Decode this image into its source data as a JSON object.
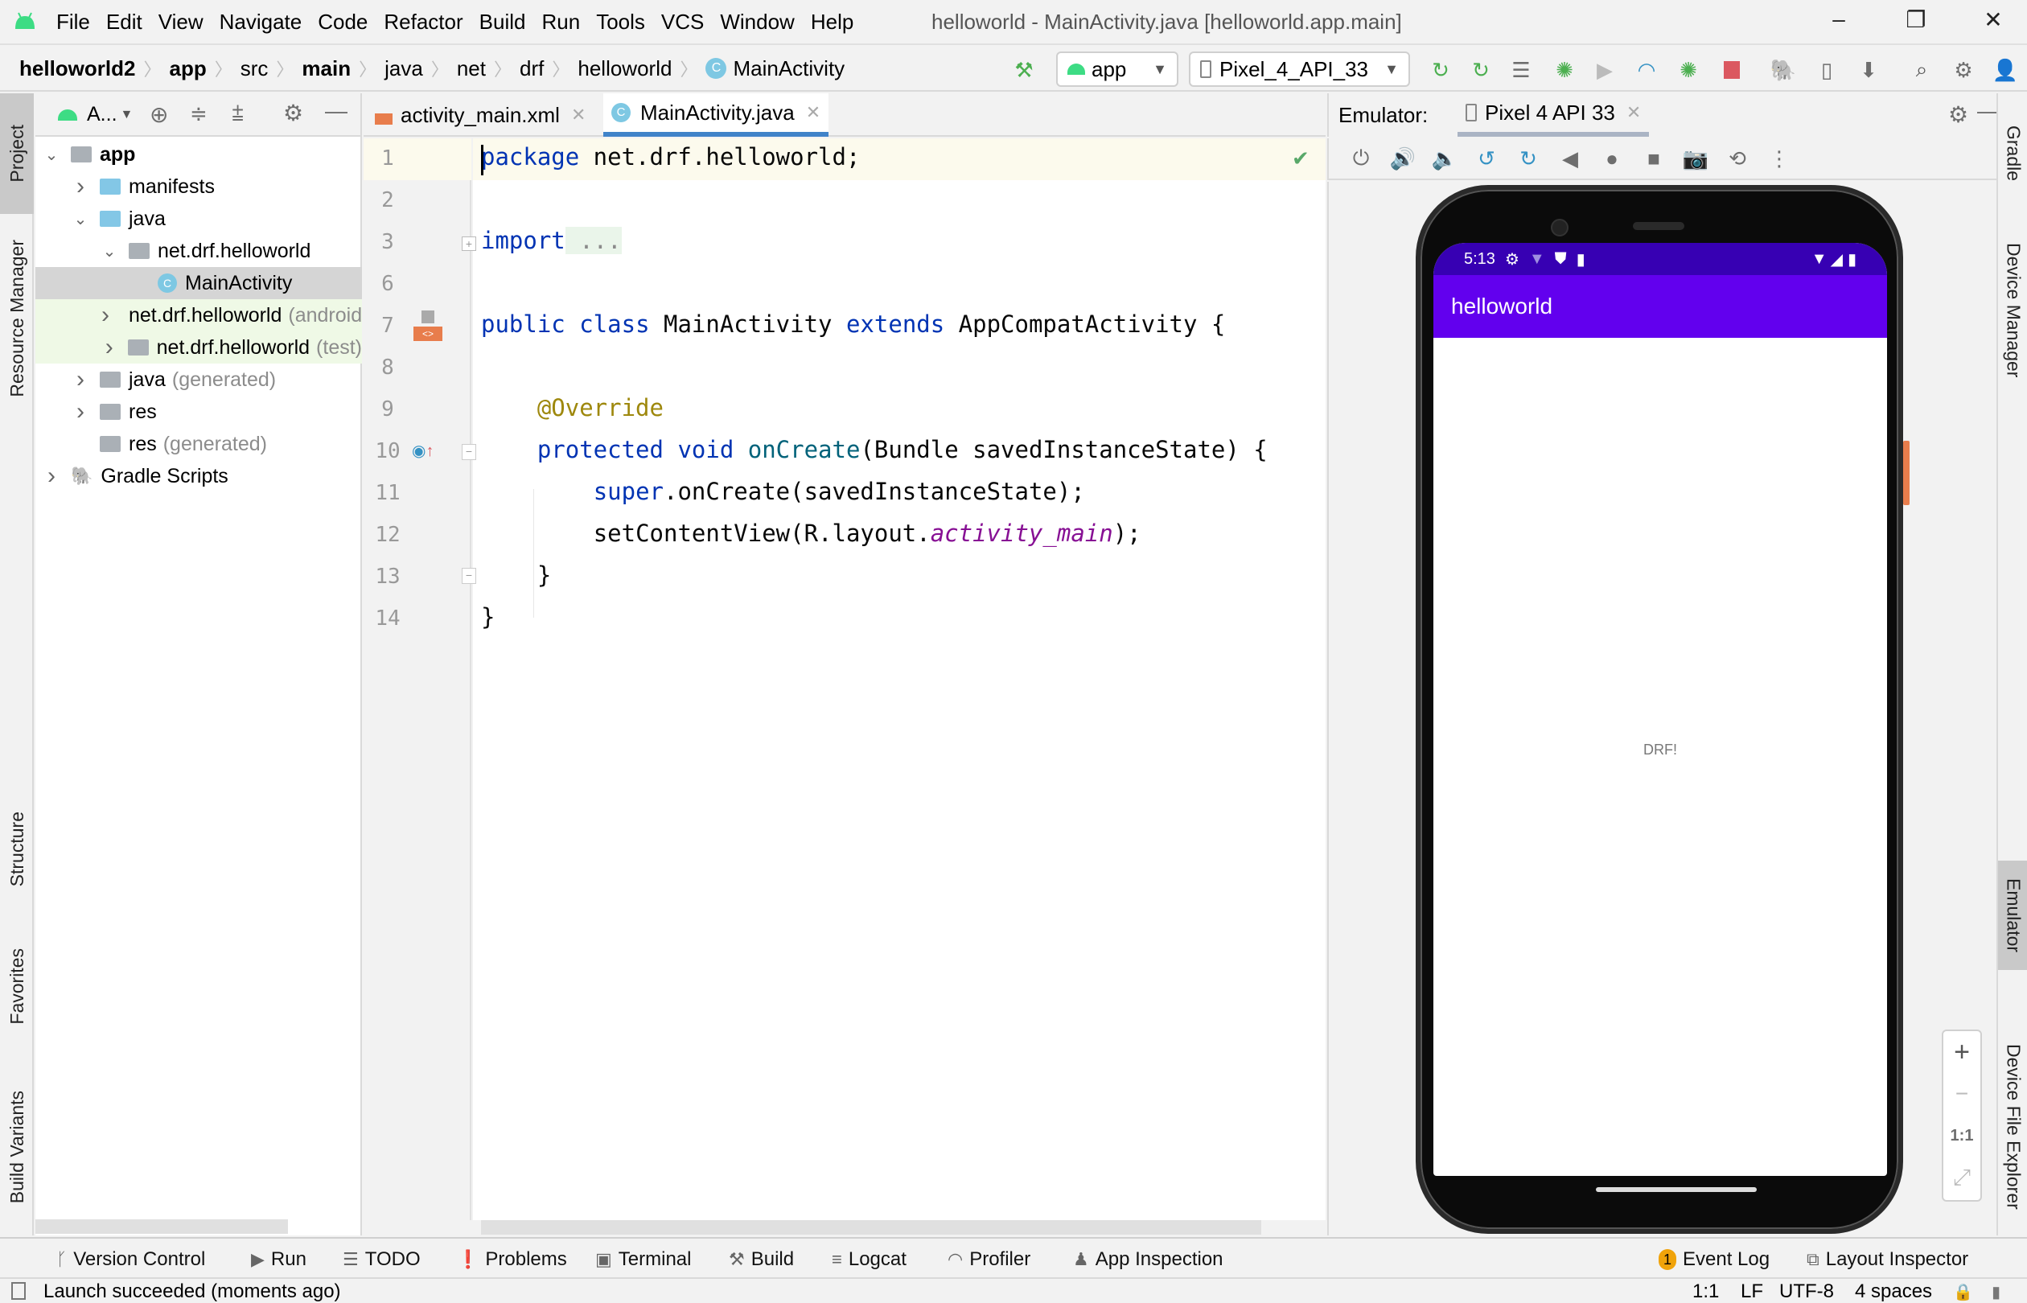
{
  "app": {
    "window_title": "helloworld - MainActivity.java [helloworld.app.main]",
    "menu": [
      "File",
      "Edit",
      "View",
      "Navigate",
      "Code",
      "Refactor",
      "Build",
      "Run",
      "Tools",
      "VCS",
      "Window",
      "Help"
    ],
    "window_controls": {
      "minimize": "–",
      "restore": "❐",
      "close": "✕"
    }
  },
  "breadcrumb": [
    "helloworld2",
    "app",
    "src",
    "main",
    "java",
    "net",
    "drf",
    "helloworld",
    "MainActivity"
  ],
  "toolbar": {
    "run_config": "app",
    "device": "Pixel_4_API_33",
    "icons": [
      "hammer-icon",
      "rerun-icon",
      "apply-changes-icon",
      "apply-code-changes-icon",
      "debug-icon",
      "attach-debugger-icon",
      "profile-icon",
      "debug-app-icon",
      "stop-icon",
      "sync-gradle-icon",
      "device-manager-icon",
      "sdk-manager-icon",
      "search-icon",
      "settings-icon",
      "account-icon"
    ],
    "stop_color": "#db5860",
    "android_green": "#3ddc84"
  },
  "left_stripe": {
    "top": [
      "Project",
      "Resource Manager"
    ],
    "bottom": [
      "Structure",
      "Favorites",
      "Build Variants"
    ]
  },
  "project_panel": {
    "view_selector": "A...",
    "tree": [
      {
        "label": "app",
        "level": 0,
        "expanded": true,
        "bold": true
      },
      {
        "label": "manifests",
        "level": 1,
        "expanded": false
      },
      {
        "label": "java",
        "level": 1,
        "expanded": true
      },
      {
        "label": "net.drf.helloworld",
        "level": 2,
        "expanded": true
      },
      {
        "label": "MainActivity",
        "level": 3,
        "selected": true
      },
      {
        "label": "net.drf.helloworld",
        "suffix": "(androidTest)",
        "level": 2,
        "expanded": false
      },
      {
        "label": "net.drf.helloworld",
        "suffix": "(test)",
        "level": 2,
        "expanded": false
      },
      {
        "label": "java",
        "suffix": "(generated)",
        "level": 1,
        "expanded": false
      },
      {
        "label": "res",
        "level": 1,
        "expanded": false
      },
      {
        "label": "res",
        "suffix": "(generated)",
        "level": 1
      },
      {
        "label": "Gradle Scripts",
        "level": 0,
        "expanded": false
      }
    ]
  },
  "editor": {
    "tabs": [
      {
        "label": "activity_main.xml",
        "active": false
      },
      {
        "label": "MainActivity.java",
        "active": true
      }
    ],
    "line_numbers": [
      "1",
      "2",
      "3",
      "6",
      "7",
      "8",
      "9",
      "10",
      "11",
      "12",
      "13",
      "14"
    ],
    "lines": {
      "l1_kw": "package",
      "l1_rest": " net.drf.helloworld;",
      "l3_kw": "import",
      "l3_fold": " ...",
      "l7_kw1": "public",
      "l7_kw2": " class",
      "l7_name": " MainActivity",
      "l7_kw3": " extends",
      "l7_rest": " AppCompatActivity {",
      "l9_ann": "@Override",
      "l10_kw1": "protected",
      "l10_kw2": " void",
      "l10_fn": " onCreate",
      "l10_rest": "(Bundle savedInstanceState) {",
      "l11_kw": "super",
      "l11_rest": ".onCreate(savedInstanceState);",
      "l12_a": "setContentView(R.layout.",
      "l12_it": "activity_main",
      "l12_b": ");",
      "l13": "}",
      "l14": "}"
    }
  },
  "emulator": {
    "label": "Emulator:",
    "device_tab": "Pixel 4 API 33",
    "controls": [
      "power-icon",
      "volume-up-icon",
      "volume-down-icon",
      "rotate-left-icon",
      "rotate-right-icon",
      "back-icon",
      "home-icon",
      "overview-icon",
      "screenshot-icon",
      "snapshot-icon",
      "more-icon"
    ],
    "phone": {
      "time": "5:13",
      "app_title": "helloworld",
      "content_text": "DRF!",
      "statusbar_color": "#3700b3",
      "appbar_color": "#6200ee"
    },
    "zoom_controls": [
      "+",
      "−",
      "1:1",
      "⤢"
    ]
  },
  "right_stripe": [
    "Gradle",
    "Device Manager",
    "Emulator",
    "Device File Explorer"
  ],
  "bottom_tools": {
    "left": [
      "Version Control",
      "Run",
      "TODO",
      "Problems",
      "Terminal",
      "Build",
      "Logcat",
      "Profiler",
      "App Inspection"
    ],
    "right": [
      {
        "label": "Event Log",
        "badge": "1"
      },
      {
        "label": "Layout Inspector"
      }
    ]
  },
  "status": {
    "message": "Launch succeeded (moments ago)",
    "position": "1:1",
    "line_sep": "LF",
    "encoding": "UTF-8",
    "indent": "4 spaces"
  }
}
